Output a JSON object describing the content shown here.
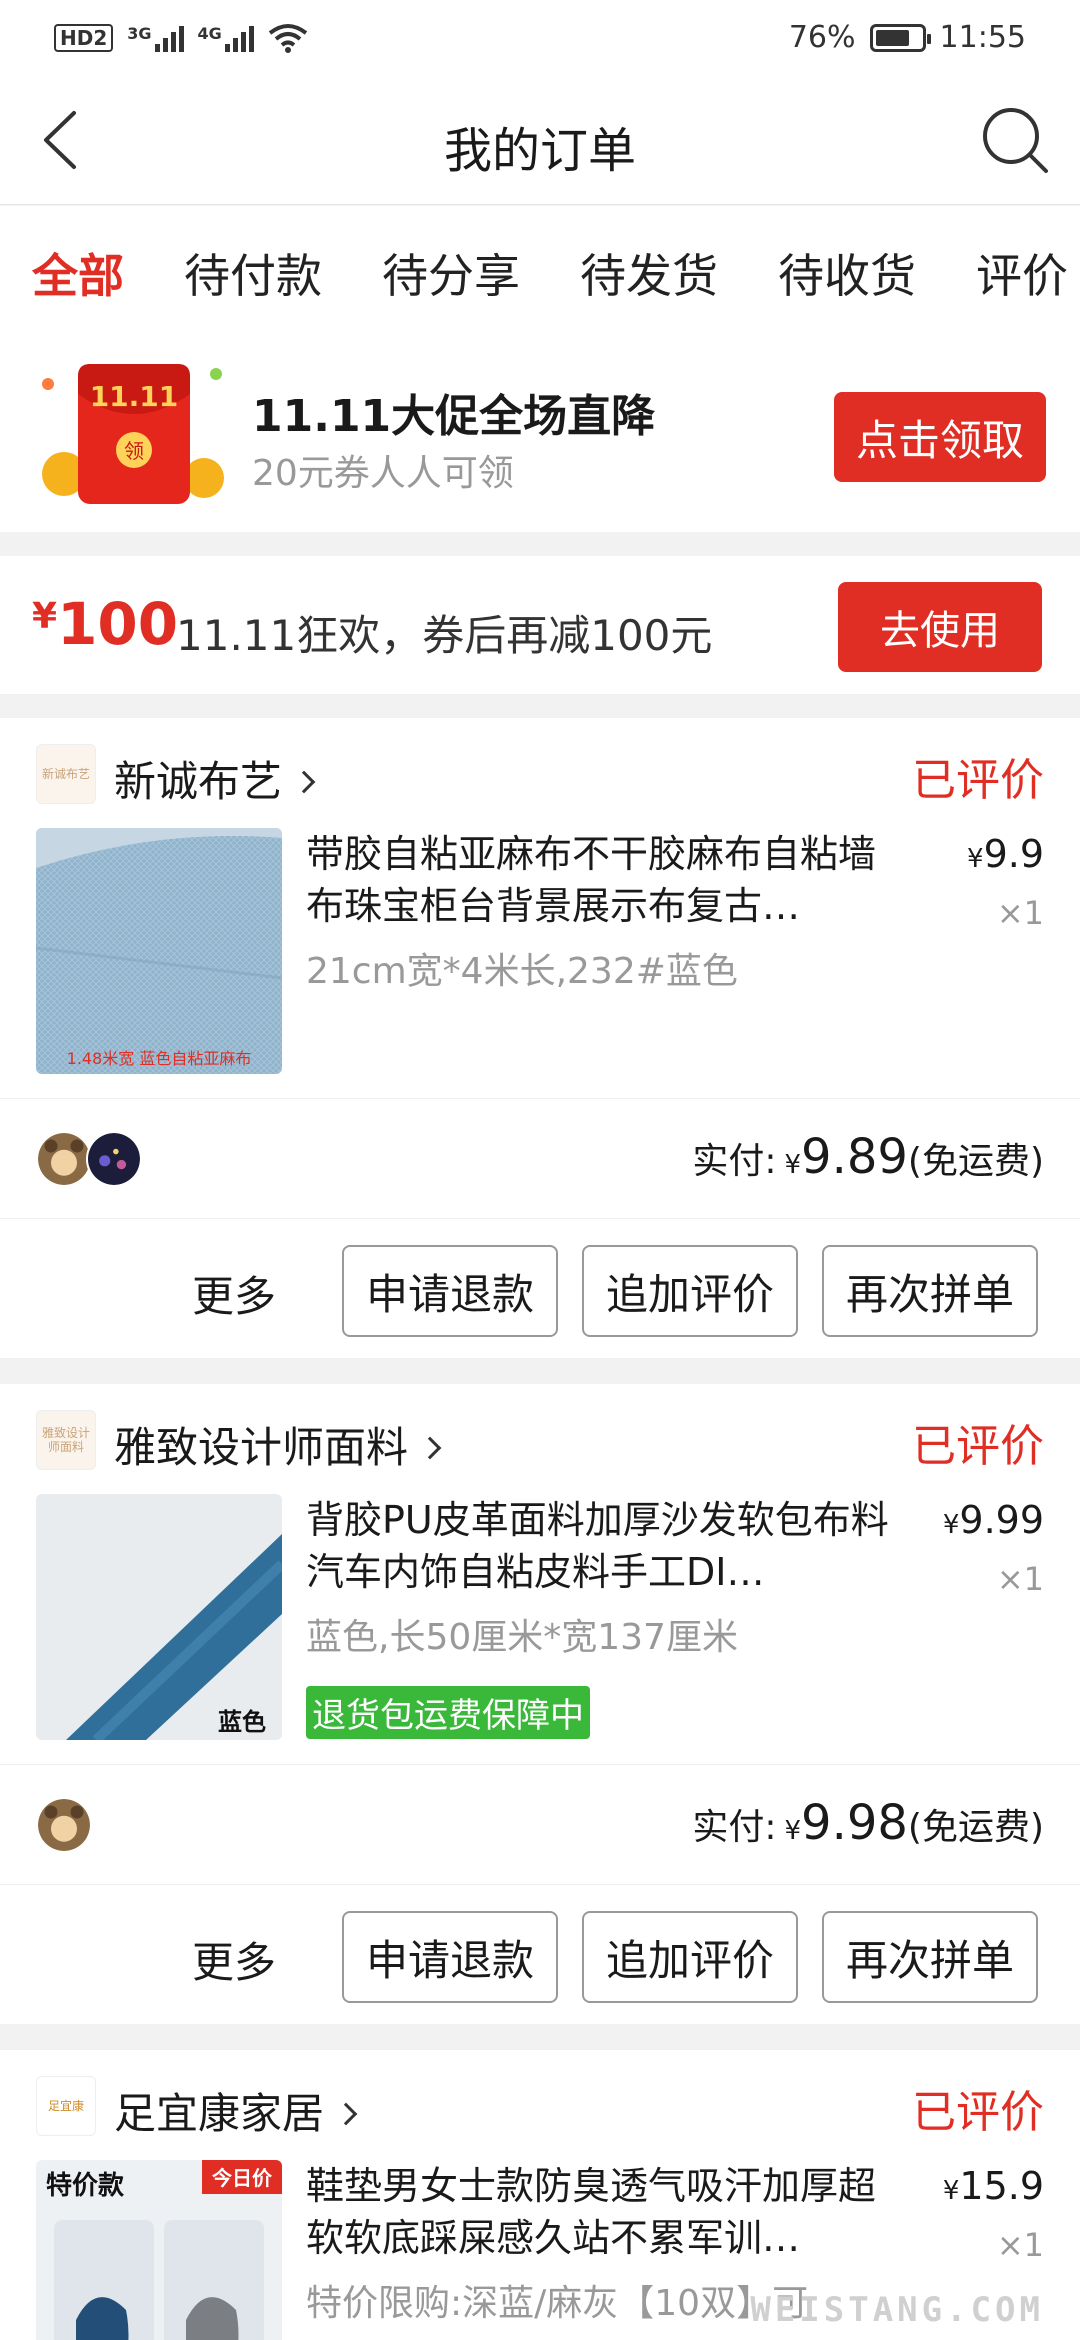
{
  "status_bar": {
    "left_tag": "HD2",
    "sig1_label": "3G",
    "sig2_label": "4G",
    "battery_pct": "76%",
    "battery_level": 0.76,
    "time": "11:55"
  },
  "nav": {
    "title": "我的订单",
    "back_icon": "chevron-left-icon",
    "search_icon": "search-icon"
  },
  "tabs": [
    {
      "label": "全部",
      "active": true
    },
    {
      "label": "待付款"
    },
    {
      "label": "待分享"
    },
    {
      "label": "待发货"
    },
    {
      "label": "待收货"
    },
    {
      "label": "评价"
    }
  ],
  "promo": {
    "badge_text": "11.11",
    "envelope_char": "领",
    "title": "11.11大促全场直降",
    "subtitle": "20元券人人可领",
    "button": "点击领取"
  },
  "coupon": {
    "currency": "¥",
    "amount": "100",
    "text": "11.11狂欢，券后再减100元",
    "button": "去使用"
  },
  "orders": [
    {
      "shop_logo_text": "新诚布艺",
      "shop": "新诚布艺",
      "status": "已评价",
      "title": "带胶自粘亚麻布不干胶麻布自粘墙布珠宝柜台背景展示布复古…",
      "spec": "21cm宽*4米长,232#蓝色",
      "thumb_caption": "1.48米宽   蓝色自粘亚麻布",
      "price_currency": "¥",
      "price": "9.9",
      "qty": "×1",
      "pay_label": "实付:",
      "pay_currency": "¥",
      "pay_amount": "9.89",
      "pay_note": "(免运费)",
      "more": "更多",
      "buttons": [
        "申请退款",
        "追加评价",
        "再次拼单"
      ]
    },
    {
      "shop_logo_text": "雅致设计师面料",
      "shop": "雅致设计师面料",
      "status": "已评价",
      "title": "背胶PU皮革面料加厚沙发软包布料汽车内饰自粘皮料手工DI…",
      "spec": "蓝色,长50厘米*宽137厘米",
      "tag": "退货包运费保障中",
      "thumb_caption": "蓝色",
      "price_currency": "¥",
      "price": "9.99",
      "qty": "×1",
      "pay_label": "实付:",
      "pay_currency": "¥",
      "pay_amount": "9.98",
      "pay_note": "(免运费)",
      "more": "更多",
      "buttons": [
        "申请退款",
        "追加评价",
        "再次拼单"
      ]
    },
    {
      "shop_logo_text": "足宜康",
      "shop": "足宜康家居",
      "status": "已评价",
      "title": "鞋垫男女士款防臭透气吸汗加厚超软软底踩屎感久站不累军训…",
      "spec": "特价限购:深蓝/麻灰【10双】可",
      "thumb_label_left": "特价款",
      "thumb_label_right": "今日价",
      "price_currency": "¥",
      "price": "15.9",
      "qty": "×1"
    }
  ],
  "watermark": "WEISTANG.COM",
  "colors": {
    "accent": "#e02e24",
    "tag_green": "#3ab83a",
    "muted": "#999999",
    "background": "#f2f2f2"
  }
}
